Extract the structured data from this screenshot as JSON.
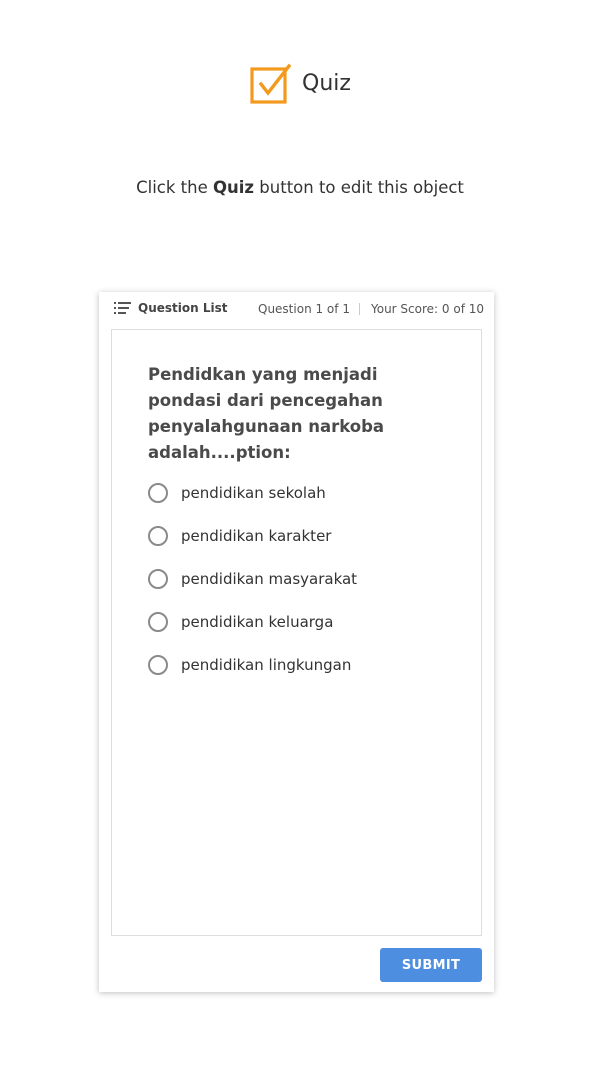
{
  "header": {
    "logo_icon": "checkbox-check-icon",
    "title": "Quiz",
    "accent_color": "#F39A1E"
  },
  "instructions": {
    "prefix": "Click the ",
    "emphasis": "Quiz",
    "suffix": " button to edit this object"
  },
  "quiz": {
    "topbar": {
      "question_list_icon": "list-icon",
      "question_list_label": "Question List",
      "question_counter": "Question 1 of 1",
      "score": "Your Score: 0 of 10"
    },
    "question": {
      "text": "Pendidkan yang menjadi pondasi dari pencegahan penyalahgunaan narkoba  adalah....ption:"
    },
    "options": [
      {
        "label": "pendidikan sekolah",
        "selected": false
      },
      {
        "label": "pendidikan karakter",
        "selected": false
      },
      {
        "label": "pendidikan masyarakat",
        "selected": false
      },
      {
        "label": "pendidikan keluarga",
        "selected": false
      },
      {
        "label": "pendidikan lingkungan",
        "selected": false
      }
    ],
    "submit_label": "SUBMIT",
    "submit_color": "#4E8EE0"
  }
}
